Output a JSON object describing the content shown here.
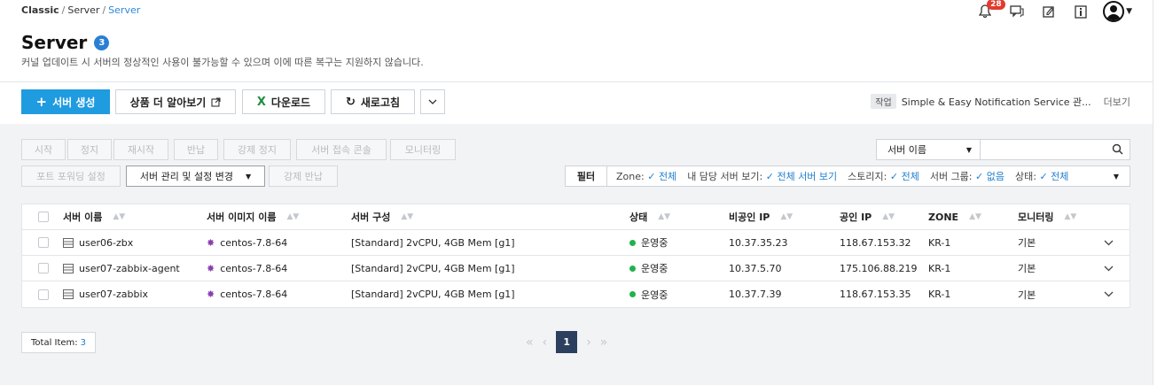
{
  "breadcrumb": {
    "root": "Classic",
    "mid": "Server",
    "current": "Server",
    "sep": "/"
  },
  "header_icons": {
    "notif_count": "28"
  },
  "page": {
    "title": "Server",
    "count": "3",
    "subtitle": "커널 업데이트 시 서버의 정상적인 사용이 불가능할 수 있으며 이에 따른 복구는 지원하지 않습니다."
  },
  "toolbar": {
    "create_label": "서버 생성",
    "learn_more_label": "상품 더 알아보기",
    "download_label": "다운로드",
    "refresh_label": "새로고침",
    "related_tag": "작업",
    "related_text": "Simple & Easy Notification Service 관...",
    "related_more": "더보기"
  },
  "actions": {
    "row1": [
      "시작",
      "정지",
      "재시작",
      "반납",
      "강제 정지",
      "서버 접속 콘솔",
      "모니터링"
    ],
    "port_forward": "포트 포워딩 설정",
    "manage": "서버 관리 및 설정 변경",
    "force_return": "강제 반납"
  },
  "search": {
    "select_value": "서버 이름",
    "placeholder": ""
  },
  "filter": {
    "label": "필터",
    "zone_label": "Zone:",
    "zone_value": "전체",
    "mine_label": "내 담당 서버 보기:",
    "mine_value": "전체 서버 보기",
    "storage_label": "스토리지:",
    "storage_value": "전체",
    "group_label": "서버 그룹:",
    "group_value": "없음",
    "status_label": "상태:",
    "status_value": "전체"
  },
  "table": {
    "headers": [
      "서버 이름",
      "서버 이미지 이름",
      "서버 구성",
      "상태",
      "비공인 IP",
      "공인 IP",
      "ZONE",
      "모니터링"
    ],
    "rows": [
      {
        "name": "user06-zbx",
        "image": "centos-7.8-64",
        "spec": "[Standard] 2vCPU, 4GB Mem [g1]",
        "status": "운영중",
        "private_ip": "10.37.35.23",
        "public_ip": "118.67.153.32",
        "zone": "KR-1",
        "monitoring": "기본"
      },
      {
        "name": "user07-zabbix-agent",
        "image": "centos-7.8-64",
        "spec": "[Standard] 2vCPU, 4GB Mem [g1]",
        "status": "운영중",
        "private_ip": "10.37.5.70",
        "public_ip": "175.106.88.219",
        "zone": "KR-1",
        "monitoring": "기본"
      },
      {
        "name": "user07-zabbix",
        "image": "centos-7.8-64",
        "spec": "[Standard] 2vCPU, 4GB Mem [g1]",
        "status": "운영중",
        "private_ip": "10.37.7.39",
        "public_ip": "118.67.153.35",
        "zone": "KR-1",
        "monitoring": "기본"
      }
    ]
  },
  "footer": {
    "total_label": "Total Item:",
    "total_value": "3",
    "page": "1"
  },
  "colors": {
    "primary": "#1f9be0",
    "link": "#1f7fcf",
    "running": "#21b24b",
    "highlight": "#f9f400",
    "pager": "#2d3f5e"
  }
}
